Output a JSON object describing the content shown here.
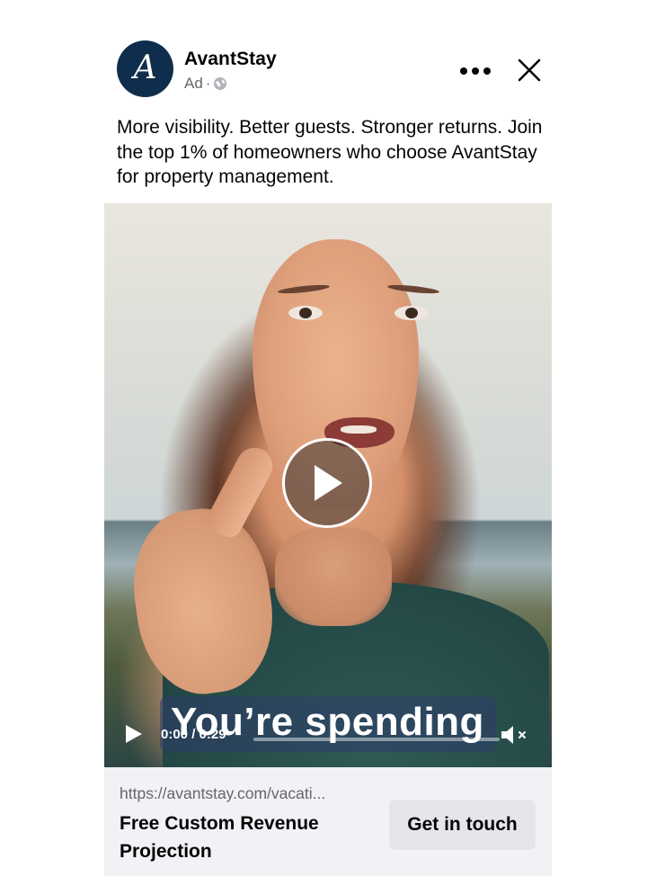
{
  "post": {
    "brand_name": "AvantStay",
    "avatar_letter": "A",
    "sponsored_label": "Ad",
    "separator": "·",
    "caption": "More visibility. Better guests. Stronger returns. Join the top 1% of homeowners who choose AvantStay for property management."
  },
  "video": {
    "subtitle": "You’re spending",
    "time": "0:00 / 0:29",
    "progress": 0,
    "muted": true
  },
  "link_card": {
    "url": "https://avantstay.com/vacati...",
    "title": "Free Custom Revenue Projection",
    "cta_label": "Get in touch"
  },
  "colors": {
    "avatar_bg": "#0f2d4c",
    "footer_bg": "#f0f2f5",
    "cta_bg": "#e4e6eb",
    "secondary_text": "#65676b"
  },
  "icons": {
    "more": "more-options-icon",
    "close": "close-icon",
    "audience": "globe-icon",
    "play": "play-icon",
    "volume": "volume-muted-icon"
  }
}
